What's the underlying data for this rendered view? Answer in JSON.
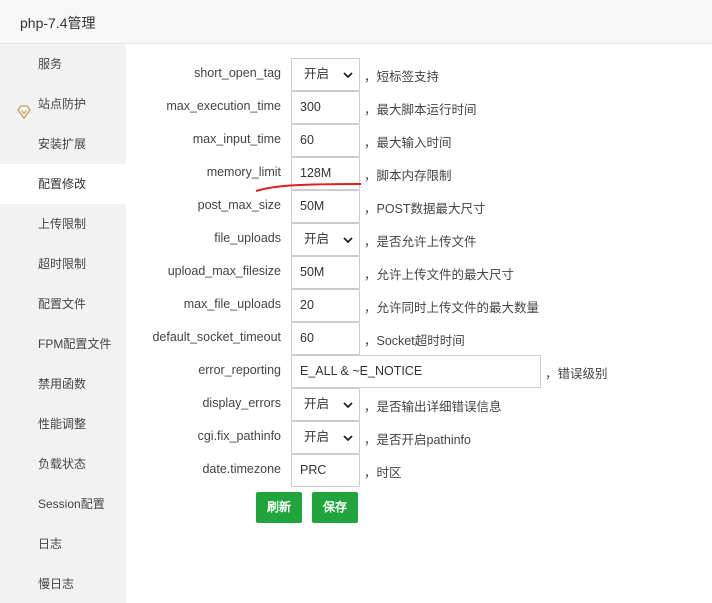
{
  "window": {
    "title": "php-7.4管理"
  },
  "sidebar": {
    "items": [
      {
        "label": "服务",
        "active": false
      },
      {
        "label": "站点防护",
        "active": false,
        "icon": "diamond-shield-icon"
      },
      {
        "label": "安装扩展",
        "active": false
      },
      {
        "label": "配置修改",
        "active": true
      },
      {
        "label": "上传限制",
        "active": false
      },
      {
        "label": "超时限制",
        "active": false
      },
      {
        "label": "配置文件",
        "active": false
      },
      {
        "label": "FPM配置文件",
        "active": false
      },
      {
        "label": "禁用函数",
        "active": false
      },
      {
        "label": "性能调整",
        "active": false
      },
      {
        "label": "负载状态",
        "active": false
      },
      {
        "label": "Session配置",
        "active": false
      },
      {
        "label": "日志",
        "active": false
      },
      {
        "label": "慢日志",
        "active": false
      }
    ]
  },
  "config": {
    "rows": [
      {
        "name": "short_open_tag",
        "type": "select",
        "value": "开启",
        "desc": "，短标签支持"
      },
      {
        "name": "max_execution_time",
        "type": "input",
        "value": "300",
        "desc": "，最大脚本运行时间"
      },
      {
        "name": "max_input_time",
        "type": "input",
        "value": "60",
        "desc": "，最大输入时间"
      },
      {
        "name": "memory_limit",
        "type": "input",
        "value": "128M",
        "desc": "，脚本内存限制"
      },
      {
        "name": "post_max_size",
        "type": "input",
        "value": "50M",
        "desc": "，POST数据最大尺寸"
      },
      {
        "name": "file_uploads",
        "type": "select",
        "value": "开启",
        "desc": "，是否允许上传文件"
      },
      {
        "name": "upload_max_filesize",
        "type": "input",
        "value": "50M",
        "desc": "，允许上传文件的最大尺寸"
      },
      {
        "name": "max_file_uploads",
        "type": "input",
        "value": "20",
        "desc": "，允许同时上传文件的最大数量"
      },
      {
        "name": "default_socket_timeout",
        "type": "input",
        "value": "60",
        "desc": "，Socket超时时间"
      },
      {
        "name": "error_reporting",
        "type": "wide",
        "value": "E_ALL & ~E_NOTICE",
        "desc": "，错误级别"
      },
      {
        "name": "display_errors",
        "type": "select",
        "value": "开启",
        "desc": "，是否输出详细错误信息"
      },
      {
        "name": "cgi.fix_pathinfo",
        "type": "select",
        "value": "开启",
        "desc": "，是否开启pathinfo"
      },
      {
        "name": "date.timezone",
        "type": "input",
        "value": "PRC",
        "desc": "，时区"
      }
    ]
  },
  "buttons": {
    "refresh": "刷新",
    "save": "保存"
  },
  "colors": {
    "accent": "#20a53a",
    "annotation": "#e02020"
  }
}
